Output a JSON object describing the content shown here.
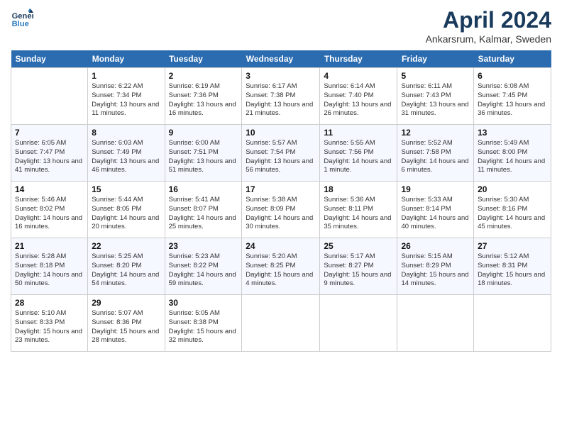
{
  "header": {
    "logo_line1": "General",
    "logo_line2": "Blue",
    "month": "April 2024",
    "location": "Ankarsrum, Kalmar, Sweden"
  },
  "weekdays": [
    "Sunday",
    "Monday",
    "Tuesday",
    "Wednesday",
    "Thursday",
    "Friday",
    "Saturday"
  ],
  "weeks": [
    [
      {
        "day": "",
        "sunrise": "",
        "sunset": "",
        "daylight": ""
      },
      {
        "day": "1",
        "sunrise": "Sunrise: 6:22 AM",
        "sunset": "Sunset: 7:34 PM",
        "daylight": "Daylight: 13 hours and 11 minutes."
      },
      {
        "day": "2",
        "sunrise": "Sunrise: 6:19 AM",
        "sunset": "Sunset: 7:36 PM",
        "daylight": "Daylight: 13 hours and 16 minutes."
      },
      {
        "day": "3",
        "sunrise": "Sunrise: 6:17 AM",
        "sunset": "Sunset: 7:38 PM",
        "daylight": "Daylight: 13 hours and 21 minutes."
      },
      {
        "day": "4",
        "sunrise": "Sunrise: 6:14 AM",
        "sunset": "Sunset: 7:40 PM",
        "daylight": "Daylight: 13 hours and 26 minutes."
      },
      {
        "day": "5",
        "sunrise": "Sunrise: 6:11 AM",
        "sunset": "Sunset: 7:43 PM",
        "daylight": "Daylight: 13 hours and 31 minutes."
      },
      {
        "day": "6",
        "sunrise": "Sunrise: 6:08 AM",
        "sunset": "Sunset: 7:45 PM",
        "daylight": "Daylight: 13 hours and 36 minutes."
      }
    ],
    [
      {
        "day": "7",
        "sunrise": "Sunrise: 6:05 AM",
        "sunset": "Sunset: 7:47 PM",
        "daylight": "Daylight: 13 hours and 41 minutes."
      },
      {
        "day": "8",
        "sunrise": "Sunrise: 6:03 AM",
        "sunset": "Sunset: 7:49 PM",
        "daylight": "Daylight: 13 hours and 46 minutes."
      },
      {
        "day": "9",
        "sunrise": "Sunrise: 6:00 AM",
        "sunset": "Sunset: 7:51 PM",
        "daylight": "Daylight: 13 hours and 51 minutes."
      },
      {
        "day": "10",
        "sunrise": "Sunrise: 5:57 AM",
        "sunset": "Sunset: 7:54 PM",
        "daylight": "Daylight: 13 hours and 56 minutes."
      },
      {
        "day": "11",
        "sunrise": "Sunrise: 5:55 AM",
        "sunset": "Sunset: 7:56 PM",
        "daylight": "Daylight: 14 hours and 1 minute."
      },
      {
        "day": "12",
        "sunrise": "Sunrise: 5:52 AM",
        "sunset": "Sunset: 7:58 PM",
        "daylight": "Daylight: 14 hours and 6 minutes."
      },
      {
        "day": "13",
        "sunrise": "Sunrise: 5:49 AM",
        "sunset": "Sunset: 8:00 PM",
        "daylight": "Daylight: 14 hours and 11 minutes."
      }
    ],
    [
      {
        "day": "14",
        "sunrise": "Sunrise: 5:46 AM",
        "sunset": "Sunset: 8:02 PM",
        "daylight": "Daylight: 14 hours and 16 minutes."
      },
      {
        "day": "15",
        "sunrise": "Sunrise: 5:44 AM",
        "sunset": "Sunset: 8:05 PM",
        "daylight": "Daylight: 14 hours and 20 minutes."
      },
      {
        "day": "16",
        "sunrise": "Sunrise: 5:41 AM",
        "sunset": "Sunset: 8:07 PM",
        "daylight": "Daylight: 14 hours and 25 minutes."
      },
      {
        "day": "17",
        "sunrise": "Sunrise: 5:38 AM",
        "sunset": "Sunset: 8:09 PM",
        "daylight": "Daylight: 14 hours and 30 minutes."
      },
      {
        "day": "18",
        "sunrise": "Sunrise: 5:36 AM",
        "sunset": "Sunset: 8:11 PM",
        "daylight": "Daylight: 14 hours and 35 minutes."
      },
      {
        "day": "19",
        "sunrise": "Sunrise: 5:33 AM",
        "sunset": "Sunset: 8:14 PM",
        "daylight": "Daylight: 14 hours and 40 minutes."
      },
      {
        "day": "20",
        "sunrise": "Sunrise: 5:30 AM",
        "sunset": "Sunset: 8:16 PM",
        "daylight": "Daylight: 14 hours and 45 minutes."
      }
    ],
    [
      {
        "day": "21",
        "sunrise": "Sunrise: 5:28 AM",
        "sunset": "Sunset: 8:18 PM",
        "daylight": "Daylight: 14 hours and 50 minutes."
      },
      {
        "day": "22",
        "sunrise": "Sunrise: 5:25 AM",
        "sunset": "Sunset: 8:20 PM",
        "daylight": "Daylight: 14 hours and 54 minutes."
      },
      {
        "day": "23",
        "sunrise": "Sunrise: 5:23 AM",
        "sunset": "Sunset: 8:22 PM",
        "daylight": "Daylight: 14 hours and 59 minutes."
      },
      {
        "day": "24",
        "sunrise": "Sunrise: 5:20 AM",
        "sunset": "Sunset: 8:25 PM",
        "daylight": "Daylight: 15 hours and 4 minutes."
      },
      {
        "day": "25",
        "sunrise": "Sunrise: 5:17 AM",
        "sunset": "Sunset: 8:27 PM",
        "daylight": "Daylight: 15 hours and 9 minutes."
      },
      {
        "day": "26",
        "sunrise": "Sunrise: 5:15 AM",
        "sunset": "Sunset: 8:29 PM",
        "daylight": "Daylight: 15 hours and 14 minutes."
      },
      {
        "day": "27",
        "sunrise": "Sunrise: 5:12 AM",
        "sunset": "Sunset: 8:31 PM",
        "daylight": "Daylight: 15 hours and 18 minutes."
      }
    ],
    [
      {
        "day": "28",
        "sunrise": "Sunrise: 5:10 AM",
        "sunset": "Sunset: 8:33 PM",
        "daylight": "Daylight: 15 hours and 23 minutes."
      },
      {
        "day": "29",
        "sunrise": "Sunrise: 5:07 AM",
        "sunset": "Sunset: 8:36 PM",
        "daylight": "Daylight: 15 hours and 28 minutes."
      },
      {
        "day": "30",
        "sunrise": "Sunrise: 5:05 AM",
        "sunset": "Sunset: 8:38 PM",
        "daylight": "Daylight: 15 hours and 32 minutes."
      },
      {
        "day": "",
        "sunrise": "",
        "sunset": "",
        "daylight": ""
      },
      {
        "day": "",
        "sunrise": "",
        "sunset": "",
        "daylight": ""
      },
      {
        "day": "",
        "sunrise": "",
        "sunset": "",
        "daylight": ""
      },
      {
        "day": "",
        "sunrise": "",
        "sunset": "",
        "daylight": ""
      }
    ]
  ]
}
